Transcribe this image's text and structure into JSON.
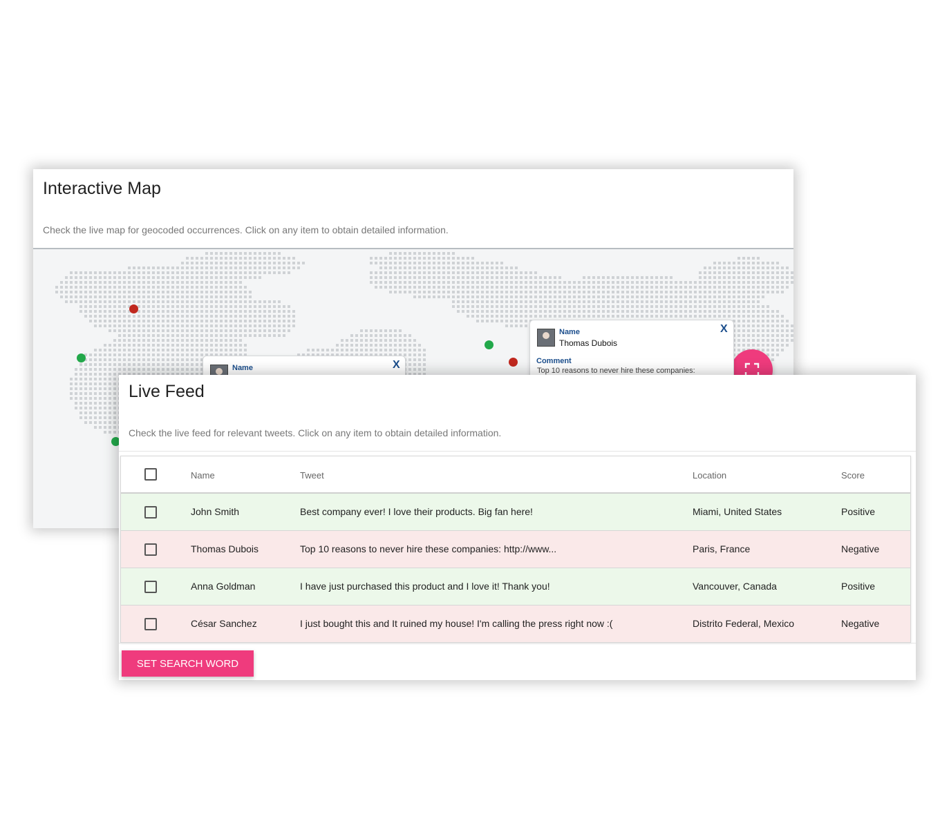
{
  "map_card": {
    "title": "Interactive Map",
    "subtitle": "Check the live map for geocoded occurrences. Click on any item to obtain detailed information.",
    "fab_icon": "fullscreen-icon",
    "popup_main": {
      "name_label": "Name",
      "name_value": "Thomas Dubois",
      "comment_label": "Comment",
      "comment_value": "Top 10 reasons to never hire these companies:",
      "close": "X"
    },
    "popup_partial": {
      "name_label": "Name",
      "close": "X"
    },
    "marker_colors": {
      "positive": "#22a84a",
      "negative": "#c0281e"
    }
  },
  "feed_card": {
    "title": "Live Feed",
    "subtitle": "Check the live feed for relevant tweets. Click on any item to obtain detailed information.",
    "columns": {
      "name": "Name",
      "tweet": "Tweet",
      "location": "Location",
      "score": "Score"
    },
    "rows": [
      {
        "name": "John Smith",
        "tweet": "Best company ever! I love their products. Big fan here!",
        "location": "Miami, United States",
        "score": "Positive"
      },
      {
        "name": "Thomas Dubois",
        "tweet": "Top 10 reasons to never hire these companies: http://www...",
        "location": "Paris, France",
        "score": "Negative"
      },
      {
        "name": "Anna Goldman",
        "tweet": "I have just purchased this product and I love it! Thank you!",
        "location": "Vancouver, Canada",
        "score": "Positive"
      },
      {
        "name": "César Sanchez",
        "tweet": "I just bought this and It ruined my house! I'm calling the press right now :(",
        "location": "Distrito Federal, Mexico",
        "score": "Negative"
      }
    ],
    "button_label": "SET SEARCH WORD"
  },
  "colors": {
    "accent": "#ef3b7d",
    "positive_row": "#ecf8ea",
    "negative_row": "#fae9e9"
  }
}
